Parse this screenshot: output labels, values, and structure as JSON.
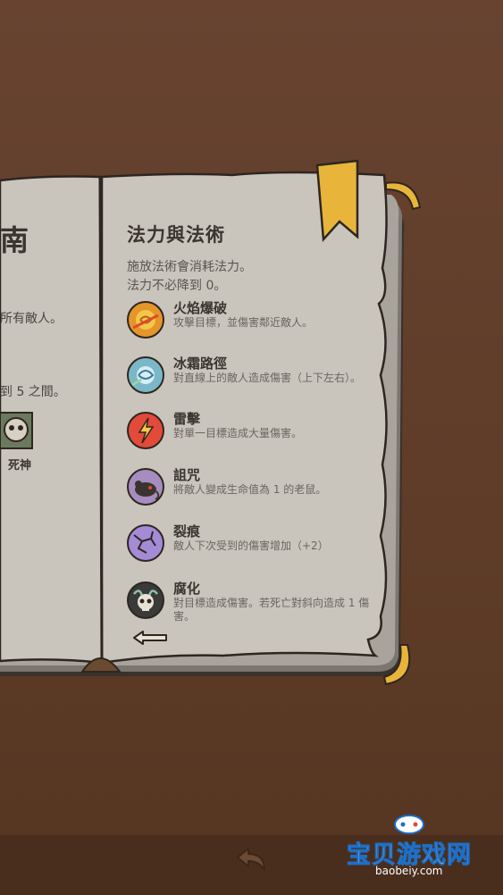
{
  "left_page": {
    "title_partial": "南",
    "line1_partial": "所有敵人。",
    "line2_partial": "到 5 之間。",
    "monster_label": "死神"
  },
  "right_page": {
    "title": "法力與法術",
    "intro_line1": "施放法術會消耗法力。",
    "intro_line2": "法力不必降到 0。",
    "spells": [
      {
        "name": "火焰爆破",
        "desc": "攻擊目標，並傷害鄰近敵人。",
        "icon": "fire-blast-icon"
      },
      {
        "name": "冰霜路徑",
        "desc": "對直線上的敵人造成傷害（上下左右）。",
        "icon": "frost-path-icon"
      },
      {
        "name": "雷擊",
        "desc": "對單一目標造成大量傷害。",
        "icon": "lightning-icon"
      },
      {
        "name": "詛咒",
        "desc": "將敵人變成生命值為 1 的老鼠。",
        "icon": "rat-curse-icon"
      },
      {
        "name": "裂痕",
        "desc": "敵人下次受到的傷害增加（+2）",
        "icon": "crack-icon"
      },
      {
        "name": "腐化",
        "desc": "對目標造成傷害。若死亡對斜向造成 1 傷害。",
        "icon": "corruption-skull-icon"
      }
    ]
  },
  "watermark": {
    "text": "宝贝游戏网",
    "url": "baobeiy.com"
  },
  "colors": {
    "background": "#5e3c28",
    "page": "#c9c5bd",
    "ink": "#3b3530",
    "bookmark": "#e8b53a"
  }
}
